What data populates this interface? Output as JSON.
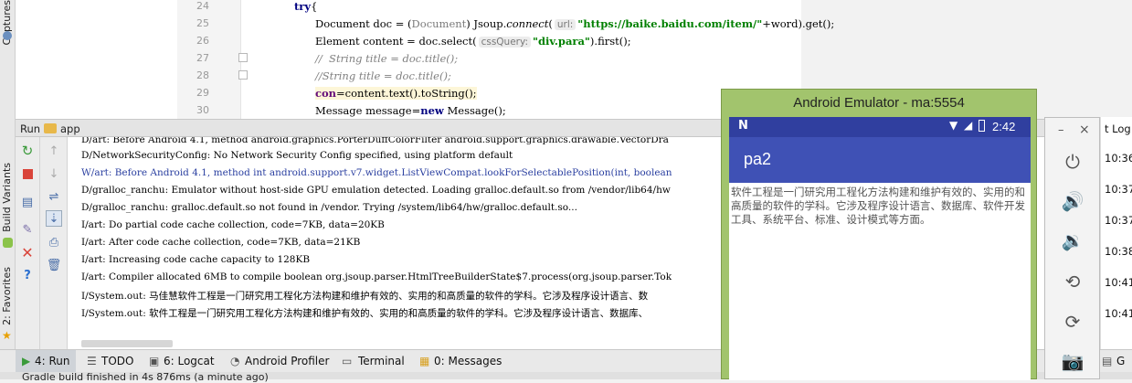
{
  "left_strip": {
    "captures": "Captures",
    "build_variants": "Build Variants",
    "favorites": "2: Favorites"
  },
  "editor": {
    "line_numbers": [
      "24",
      "25",
      "26",
      "27",
      "28",
      "29",
      "30"
    ],
    "lines": {
      "l24_kw": "try",
      "l24_rest": "{",
      "l25_a": "Document doc = (",
      "l25_cast": "Document",
      "l25_b": ") Jsoup.",
      "l25_fn": "connect",
      "l25_c": "(",
      "l25_hint": "url:",
      "l25_str": "\"https://baike.baidu.com/item/\"",
      "l25_d": "+word).get();",
      "l26_a": "Element content = doc.select(",
      "l26_hint": "cssQuery:",
      "l26_str": "\"div.para\"",
      "l26_b": ").first();",
      "l27": "//  String title = doc.title();",
      "l28": "//String title = doc.title();",
      "l29_a": "con",
      "l29_b": "=content.text().toString();",
      "l30_a": "Message message=",
      "l30_kw": "new",
      "l30_b": " Message();"
    }
  },
  "run_panel": {
    "run_label": "Run",
    "config_name": "app",
    "console_lines": [
      "D/art: Before Android 4.1, method android.graphics.PorterDuffColorFilter android.support.graphics.drawable.VectorDra",
      "D/NetworkSecurityConfig: No Network Security Config specified, using platform default",
      "W/art: Before Android 4.1, method int android.support.v7.widget.ListViewCompat.lookForSelectablePosition(int, boolean",
      "D/gralloc_ranchu: Emulator without host-side GPU emulation detected. Loading gralloc.default.so from /vendor/lib64/hw",
      "D/gralloc_ranchu: gralloc.default.so not found in /vendor. Trying /system/lib64/hw/gralloc.default.so...",
      "I/art: Do partial code cache collection, code=7KB, data=20KB",
      "I/art: After code cache collection, code=7KB, data=21KB",
      "I/art: Increasing code cache capacity to 128KB",
      "I/art: Compiler allocated 6MB to compile boolean org.jsoup.parser.HtmlTreeBuilderState$7.process(org.jsoup.parser.Tok",
      "I/System.out: 马佳慧软件工程是一门研究用工程化方法构建和维护有效的、实用的和高质量的软件的学科。它涉及程序设计语言、数",
      "I/System.out: 软件工程是一门研究用工程化方法构建和维护有效的、实用的和高质量的软件的学科。它涉及程序设计语言、数据库、"
    ]
  },
  "bottom_tabs": {
    "run": "4: Run",
    "todo": "TODO",
    "logcat": "6: Logcat",
    "profiler": "Android Profiler",
    "terminal": "Terminal",
    "messages": "0: Messages"
  },
  "status_text": "Gradle build finished in 4s 876ms (a minute ago)",
  "emulator": {
    "title": "Android Emulator - ma:5554",
    "time": "2:42",
    "app_title": "pa2",
    "content": "软件工程是一门研究用工程化方法构建和维护有效的、实用的和高质量的软件的学科。它涉及程序设计语言、数据库、软件开发工具、系统平台、标准、设计模式等方面。",
    "minimize": "–",
    "close": "×"
  },
  "event_log": {
    "header": "t Log",
    "times": [
      "10:36",
      "10:37",
      "10:37",
      "10:38",
      "10:41",
      "10:41"
    ],
    "bottom_tab": "G"
  },
  "colors": {
    "app_primary": "#3f51b5",
    "app_status": "#303f9f",
    "emulator_frame": "#a2c46d"
  }
}
